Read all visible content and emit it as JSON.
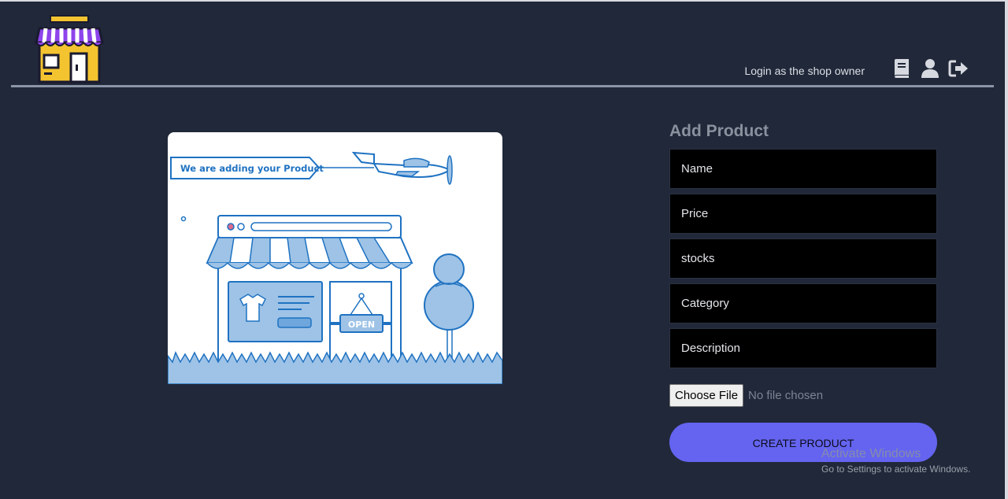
{
  "nav": {
    "login_link": "Login as the shop owner",
    "icons": [
      "book-icon",
      "user-icon",
      "sign-out-icon"
    ]
  },
  "hero": {
    "banner_text": "We are adding your Product",
    "sign_text": "OPEN"
  },
  "form": {
    "title": "Add Product",
    "fields": [
      "Name",
      "Price",
      "stocks",
      "Category",
      "Description"
    ],
    "file_button": "Choose File",
    "file_status": "No file chosen",
    "submit": "CREATE PRODUCT"
  },
  "watermark": {
    "title": "Activate Windows",
    "subtitle": "Go to Settings to activate Windows."
  },
  "colors": {
    "background": "#202839",
    "accent": "#6464f0",
    "field_bg": "#000000",
    "illustration_blue": "#1f72c2",
    "illustration_light": "#9ec3e6"
  }
}
